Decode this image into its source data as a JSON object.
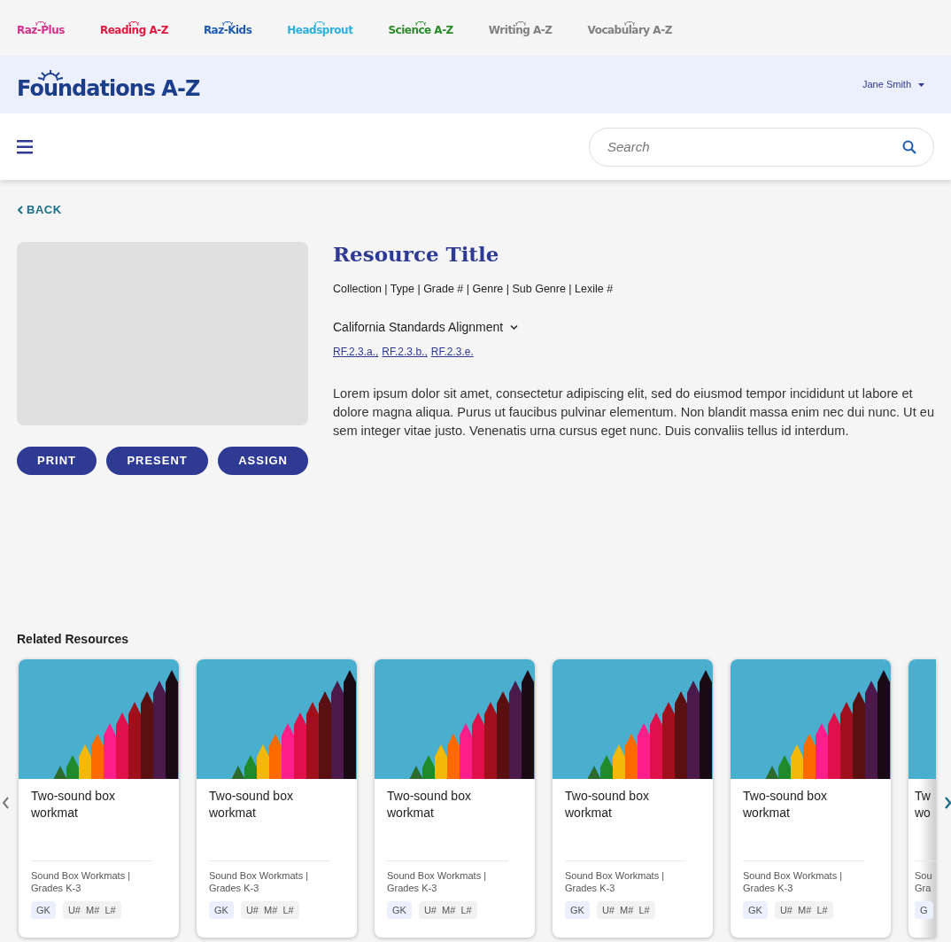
{
  "brands": [
    {
      "label": "Raz-Plus",
      "color": "#d0338c"
    },
    {
      "label": "Reading A-Z",
      "color": "#e0173f"
    },
    {
      "label": "Raz-Kids",
      "color": "#1e5bb0"
    },
    {
      "label": "Headsprout",
      "color": "#2bb0e0"
    },
    {
      "label": "Science A-Z",
      "color": "#2a8a2a"
    },
    {
      "label": "Writing A-Z",
      "color": "#808080"
    },
    {
      "label": "Vocabulary A-Z",
      "color": "#808080"
    }
  ],
  "header": {
    "logo": "Foundations A-Z",
    "user": "Jane Smith"
  },
  "search": {
    "placeholder": "Search"
  },
  "back": "BACK",
  "resource": {
    "title": "Resource Title",
    "meta": "Collection | Type | Grade # | Genre | Sub Genre | Lexile #",
    "standards_label": "California Standards Alignment",
    "standards_expanded": false,
    "standards": [
      "RF.2.3.a.,",
      "RF.2.3.b.,",
      "RF.2.3.e."
    ],
    "description": "Lorem ipsum dolor sit amet, consectetur adipiscing elit, sed do eiusmod tempor incididunt ut labore et dolore magna aliqua. Purus ut faucibus pulvinar elementum. Non blandit massa enim nec dui nunc. Ut eu sem integer vitae justo. Venenatis urna cursus eget nunc. Duis convaliis tellus id interdum.",
    "buttons": [
      "PRINT",
      "PRESENT",
      "ASSIGN"
    ]
  },
  "related": {
    "title": "Related Resources",
    "cards": [
      {
        "kind": "full",
        "title": "Two-sound box workmat",
        "meta": "Sound Box Workmats | Grades K-3",
        "tags": [
          {
            "kind": "grade",
            "text": "GK"
          },
          {
            "kind": "level",
            "text": "U#  M#  L#"
          }
        ]
      },
      {
        "kind": "full",
        "title": "Two-sound box workmat",
        "meta": "Sound Box Workmats | Grades K-3",
        "tags": [
          {
            "kind": "grade",
            "text": "GK"
          },
          {
            "kind": "level",
            "text": "U#  M#  L#"
          }
        ]
      },
      {
        "kind": "full",
        "title": "Two-sound box workmat",
        "meta": "Sound Box Workmats | Grades K-3",
        "tags": [
          {
            "kind": "grade",
            "text": "GK"
          },
          {
            "kind": "level",
            "text": "U#  M#  L#"
          }
        ]
      },
      {
        "kind": "full",
        "title": "Two-sound box workmat",
        "meta": "Sound Box Workmats | Grades K-3",
        "tags": [
          {
            "kind": "grade",
            "text": "GK"
          },
          {
            "kind": "level",
            "text": "U#  M#  L#"
          }
        ]
      },
      {
        "kind": "full",
        "title": "Two-sound box workmat",
        "meta": "Sound Box Workmats | Grades K-3",
        "tags": [
          {
            "kind": "grade",
            "text": "GK"
          },
          {
            "kind": "level",
            "text": "U#  M#  L#"
          }
        ]
      },
      {
        "kind": "partial",
        "title_lines": [
          "Tw",
          "wo"
        ],
        "meta_lines": [
          "Sou",
          "Gra"
        ],
        "tags": [
          {
            "kind": "grade",
            "text": "G"
          }
        ]
      }
    ]
  }
}
